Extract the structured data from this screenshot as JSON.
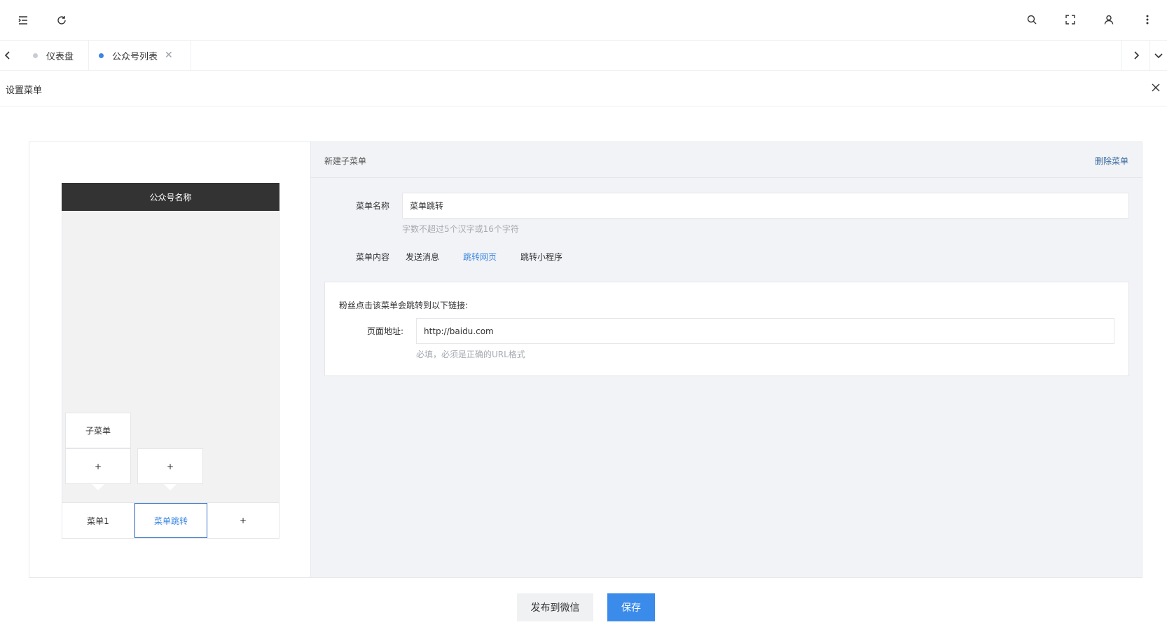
{
  "tabs": [
    {
      "label": "仪表盘",
      "active": false,
      "dot_color": "#c0c4cc"
    },
    {
      "label": "公众号列表",
      "active": true,
      "dot_color": "#3a86e0",
      "close": "✕"
    }
  ],
  "page": {
    "title": "设置菜单"
  },
  "phone": {
    "account_name": "公众号名称",
    "menus": [
      "菜单1",
      "菜单跳转",
      "+"
    ],
    "submenu_col1": [
      "子菜单",
      "+"
    ],
    "submenu_col2": [
      "+"
    ]
  },
  "editor": {
    "header_title": "新建子菜单",
    "delete_label": "删除菜单",
    "name_label": "菜单名称",
    "name_value": "菜单跳转",
    "name_hint": "字数不超过5个汉字或16个字符",
    "content_label": "菜单内容",
    "content_options": [
      "发送消息",
      "跳转网页",
      "跳转小程序"
    ],
    "content_selected": "跳转网页",
    "url_desc": "粉丝点击该菜单会跳转到以下链接:",
    "url_label": "页面地址:",
    "url_value": "http://baidu.com",
    "url_hint": "必填，必须是正确的URL格式"
  },
  "actions": {
    "publish_label": "发布到微信",
    "save_label": "保存"
  },
  "icons": [
    "menu-fold-icon",
    "refresh-icon",
    "search-icon",
    "fullscreen-icon",
    "user-icon",
    "more-vertical-icon",
    "chevron-left-icon",
    "chevron-right-icon",
    "chevron-down-icon",
    "close-icon"
  ],
  "colors": {
    "primary": "#3b8bea",
    "phone_header": "#333333",
    "editor_bg": "#f2f3f6"
  }
}
